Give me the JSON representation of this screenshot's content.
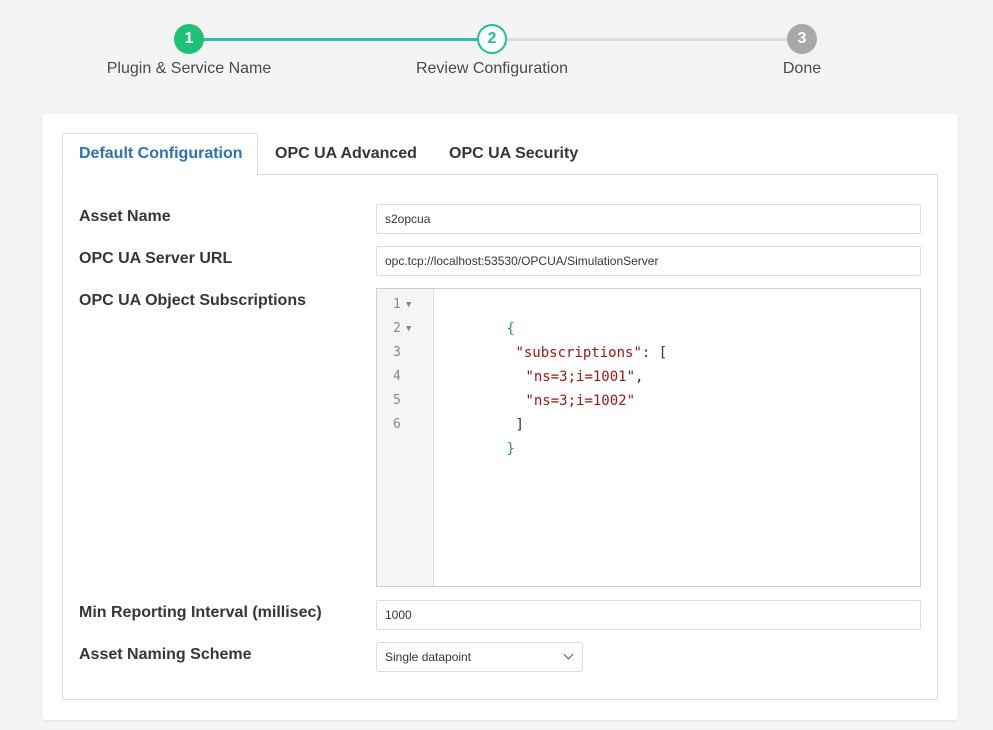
{
  "stepper": {
    "steps": [
      {
        "number": "1",
        "label": "Plugin & Service Name",
        "state": "complete"
      },
      {
        "number": "2",
        "label": "Review Configuration",
        "state": "active"
      },
      {
        "number": "3",
        "label": "Done",
        "state": "pending"
      }
    ],
    "colors": {
      "complete": "#1ec176",
      "active_border": "#1ec0a0",
      "pending": "#a8a8a8",
      "line_done": "#2cc0a7",
      "line_pending": "#dcdcdc"
    }
  },
  "tabs": [
    {
      "label": "Default Configuration",
      "active": true
    },
    {
      "label": "OPC UA Advanced",
      "active": false
    },
    {
      "label": "OPC UA Security",
      "active": false
    }
  ],
  "form": {
    "asset_name": {
      "label": "Asset Name",
      "value": "s2opcua"
    },
    "server_url": {
      "label": "OPC UA Server URL",
      "value": "opc.tcp://localhost:53530/OPCUA/SimulationServer"
    },
    "subscriptions": {
      "label": "OPC UA Object Subscriptions",
      "lines": [
        {
          "number": "1",
          "fold": true
        },
        {
          "number": "2",
          "fold": true
        },
        {
          "number": "3",
          "fold": false
        },
        {
          "number": "4",
          "fold": false
        },
        {
          "number": "5",
          "fold": false
        },
        {
          "number": "6",
          "fold": false
        }
      ],
      "code": {
        "open_brace": "{",
        "key": "\"subscriptions\"",
        "key_sep": ": [",
        "item1": "\"ns=3;i=1001\"",
        "item1_comma": ",",
        "item2": "\"ns=3;i=1002\"",
        "close_bracket": "]",
        "close_brace": "}"
      }
    },
    "min_interval": {
      "label": "Min Reporting Interval (millisec)",
      "value": "1000"
    },
    "naming_scheme": {
      "label": "Asset Naming Scheme",
      "value": "Single datapoint"
    }
  }
}
